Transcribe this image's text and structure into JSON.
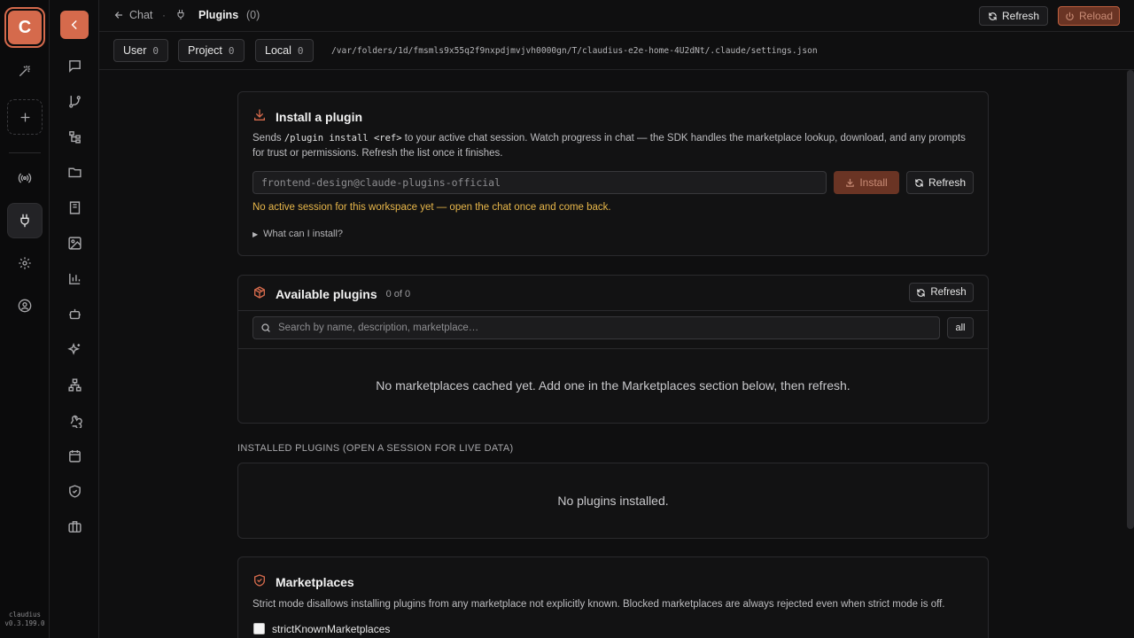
{
  "app": {
    "logo_letter": "C",
    "name": "claudius",
    "version": "v0.3.199.0"
  },
  "rail_icons": [
    "wand-icon",
    "add-icon",
    "broadcast-icon",
    "plug-icon",
    "gear-icon",
    "user-circle-icon"
  ],
  "sidebar_icons": [
    "chat-icon",
    "git-branch-icon",
    "tree-icon",
    "folder-icon",
    "book-icon",
    "image-icon",
    "chart-icon",
    "bot-icon",
    "sparkles-icon",
    "network-icon",
    "webhook-icon",
    "calendar-icon",
    "shield-icon",
    "briefcase-icon"
  ],
  "topbar": {
    "back_label": "Chat",
    "title": "Plugins",
    "count": "(0)",
    "refresh_label": "Refresh",
    "reload_label": "Reload"
  },
  "scopes": [
    {
      "label": "User",
      "count": "0"
    },
    {
      "label": "Project",
      "count": "0"
    },
    {
      "label": "Local",
      "count": "0"
    }
  ],
  "settings_path": "/var/folders/1d/fmsmls9x55q2f9nxpdjmvjvh0000gn/T/claudius-e2e-home-4U2dNt/.claude/settings.json",
  "install": {
    "title": "Install a plugin",
    "desc_pre": "Sends ",
    "desc_code": "/plugin install <ref>",
    "desc_post": " to your active chat session. Watch progress in chat — the SDK handles the marketplace lookup, download, and any prompts for trust or permissions. Refresh the list once it finishes.",
    "input_placeholder": "frontend-design@claude-plugins-official",
    "install_label": "Install",
    "refresh_label": "Refresh",
    "warning": "No active session for this workspace yet — open the chat once and come back.",
    "details_label": "What can I install?"
  },
  "available": {
    "title": "Available plugins",
    "count": "0 of 0",
    "refresh_label": "Refresh",
    "search_placeholder": "Search by name, description, marketplace…",
    "filter_label": "all",
    "empty": "No marketplaces cached yet. Add one in the Marketplaces section below, then refresh."
  },
  "installed": {
    "section_label": "INSTALLED PLUGINS (OPEN A SESSION FOR LIVE DATA)",
    "empty": "No plugins installed."
  },
  "marketplaces": {
    "title": "Marketplaces",
    "desc": "Strict mode disallows installing plugins from any marketplace not explicitly known. Blocked marketplaces are always rejected even when strict mode is off.",
    "checkbox_label": "strictKnownMarketplaces",
    "checkbox_checked": false
  },
  "colors": {
    "accent": "#d56a4c",
    "warning": "#e8b74a",
    "background": "#0f0f10"
  }
}
